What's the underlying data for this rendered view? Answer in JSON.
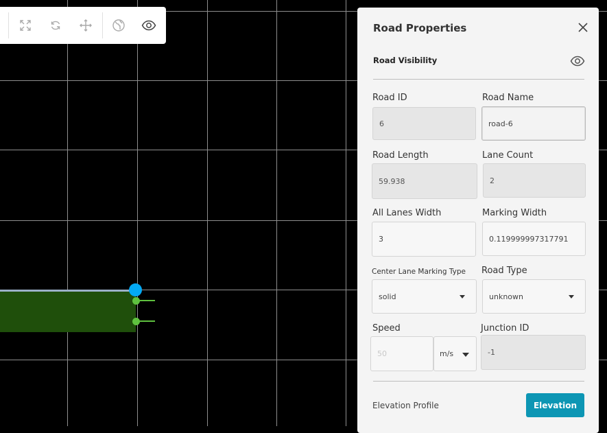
{
  "toolbar": {
    "icons": [
      "fit-screen-icon",
      "rotate-icon",
      "move-icon",
      "globe-icon",
      "eye-icon"
    ]
  },
  "panel": {
    "title": "Road Properties",
    "visibility_label": "Road Visibility",
    "fields": {
      "road_id": {
        "label": "Road ID",
        "value": "6"
      },
      "road_name": {
        "label": "Road Name",
        "value": "road-6"
      },
      "road_length": {
        "label": "Road Length",
        "value": "59.938"
      },
      "lane_count": {
        "label": "Lane Count",
        "value": "2"
      },
      "all_lanes_width": {
        "label": "All Lanes Width",
        "value": "3"
      },
      "marking_width": {
        "label": "Marking Width",
        "value": "0.119999997317791"
      },
      "center_lane_marking_type": {
        "label": "Center Lane Marking Type",
        "value": "solid"
      },
      "road_type": {
        "label": "Road Type",
        "value": "unknown"
      },
      "speed": {
        "label": "Speed",
        "placeholder": "50",
        "unit": "m/s"
      },
      "junction_id": {
        "label": "Junction ID",
        "value": "-1"
      }
    },
    "elevation": {
      "label": "Elevation Profile",
      "button": "Elevation"
    }
  },
  "colors": {
    "road": "#1f4f0b",
    "handle": "#03a9f4",
    "lane_node": "#5fc23f",
    "accent_button": "#0d96b4"
  }
}
